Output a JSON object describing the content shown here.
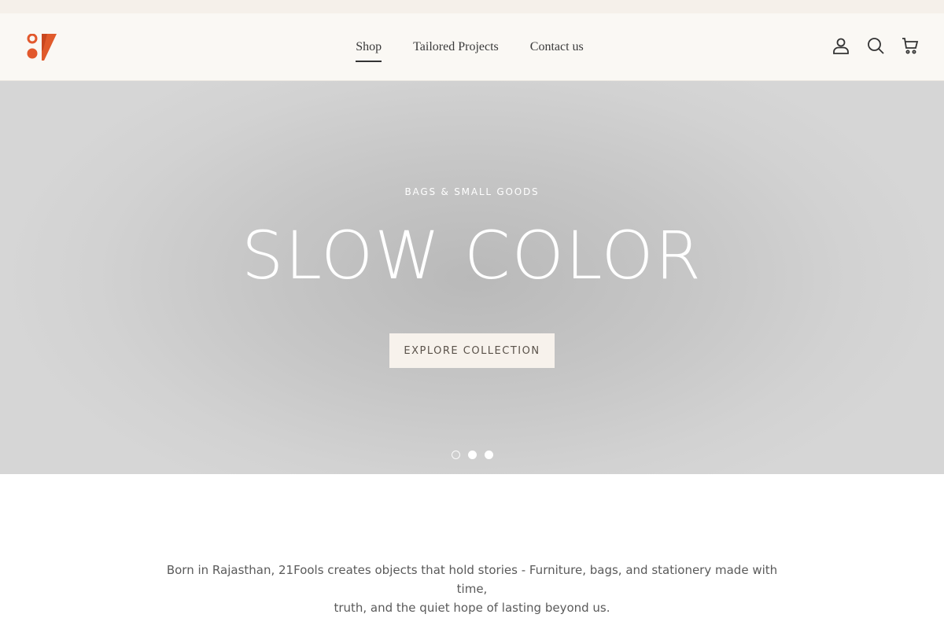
{
  "header": {
    "nav": [
      {
        "label": "Shop",
        "active": true
      },
      {
        "label": "Tailored Projects",
        "active": false
      },
      {
        "label": "Contact us",
        "active": false
      }
    ],
    "icons": [
      "account-icon",
      "search-icon",
      "cart-icon"
    ],
    "logo_colors": [
      "#e2582c",
      "#c9471f"
    ]
  },
  "hero": {
    "eyebrow": "BAGS & SMALL GOODS",
    "title": "SLOW COLOR",
    "cta_label": "EXPLORE COLLECTION",
    "slides": 3,
    "active_slide": 1
  },
  "intro": {
    "line1": "Born in Rajasthan, 21Fools creates objects that hold stories - Furniture, bags, and stationery made with time,",
    "line2": "truth, and the quiet hope of lasting beyond us."
  }
}
